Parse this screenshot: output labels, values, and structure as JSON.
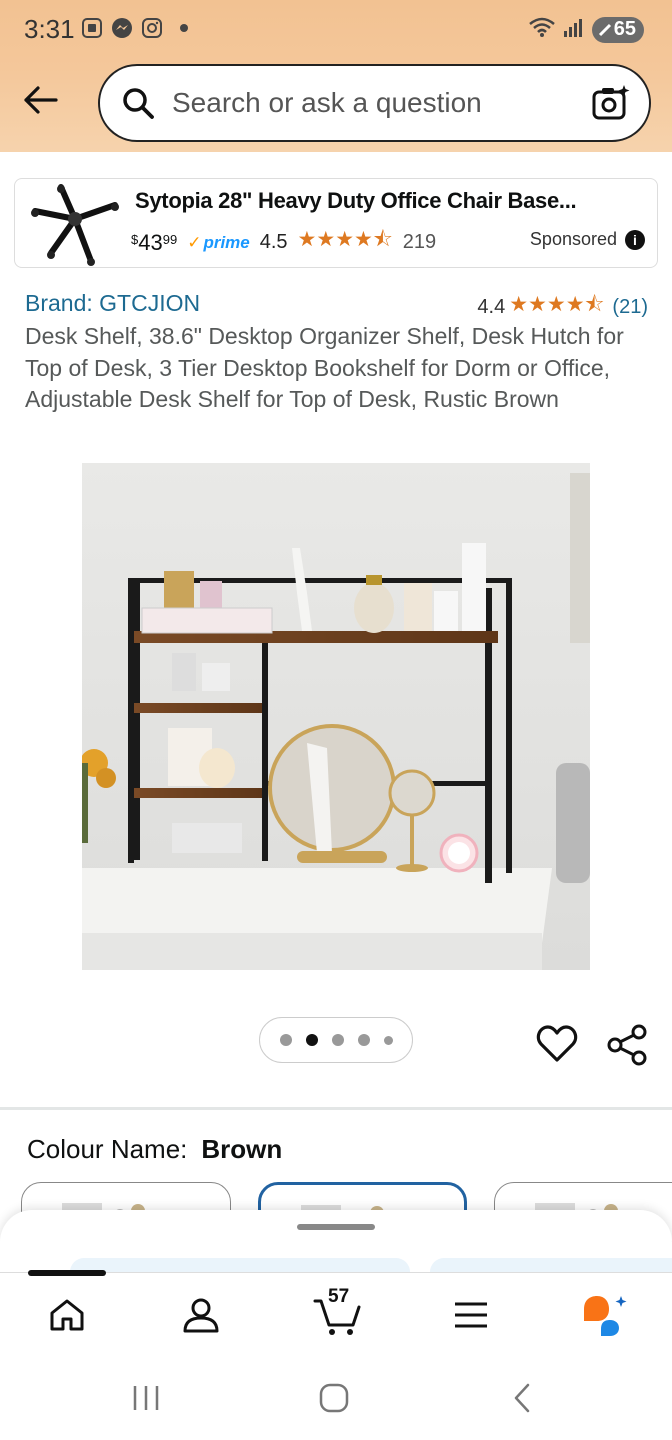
{
  "status_bar": {
    "time": "3:31",
    "battery": "65",
    "icons": [
      "screenshot-icon",
      "messenger-icon",
      "instagram-icon",
      "dot-icon",
      "wifi-icon",
      "signal-icon",
      "battery-icon"
    ]
  },
  "search": {
    "placeholder": "Search or ask a question"
  },
  "sponsored_ad": {
    "title": "Sytopia 28\" Heavy Duty Office Chair Base...",
    "price_currency": "$",
    "price_whole": "43",
    "price_fraction": "99",
    "prime_label": "prime",
    "rating": "4.5",
    "stars": "★★★★⯪",
    "review_count": "219",
    "sponsored_label": "Sponsored",
    "rating_value": 4.5
  },
  "product": {
    "brand": "Brand: GTCJION",
    "rating": "4.4",
    "stars": "★★★★⯪",
    "review_count": "(21)",
    "rating_value": 4.4,
    "title": "Desk Shelf, 38.6\" Desktop Organizer Shelf, Desk Hutch for Top of Desk, 3 Tier Desktop Bookshelf for Dorm or Office, Adjustable Desk Shelf for Top of Desk, Rustic Brown",
    "image_carousel": {
      "total": 5,
      "active_index": 1
    }
  },
  "variation": {
    "label": "Colour Name:",
    "value": "Brown"
  },
  "bottom_nav": {
    "items": [
      "home-icon",
      "account-icon",
      "cart-icon",
      "menu-icon",
      "rufus-assistant-icon"
    ],
    "cart_count": "57"
  },
  "colors": {
    "header_orange": "#f4c79a",
    "link_blue": "#1d6a91",
    "star_orange": "#de7921",
    "prime_blue": "#1a98ff",
    "selected_swatch": "#2162a1"
  }
}
